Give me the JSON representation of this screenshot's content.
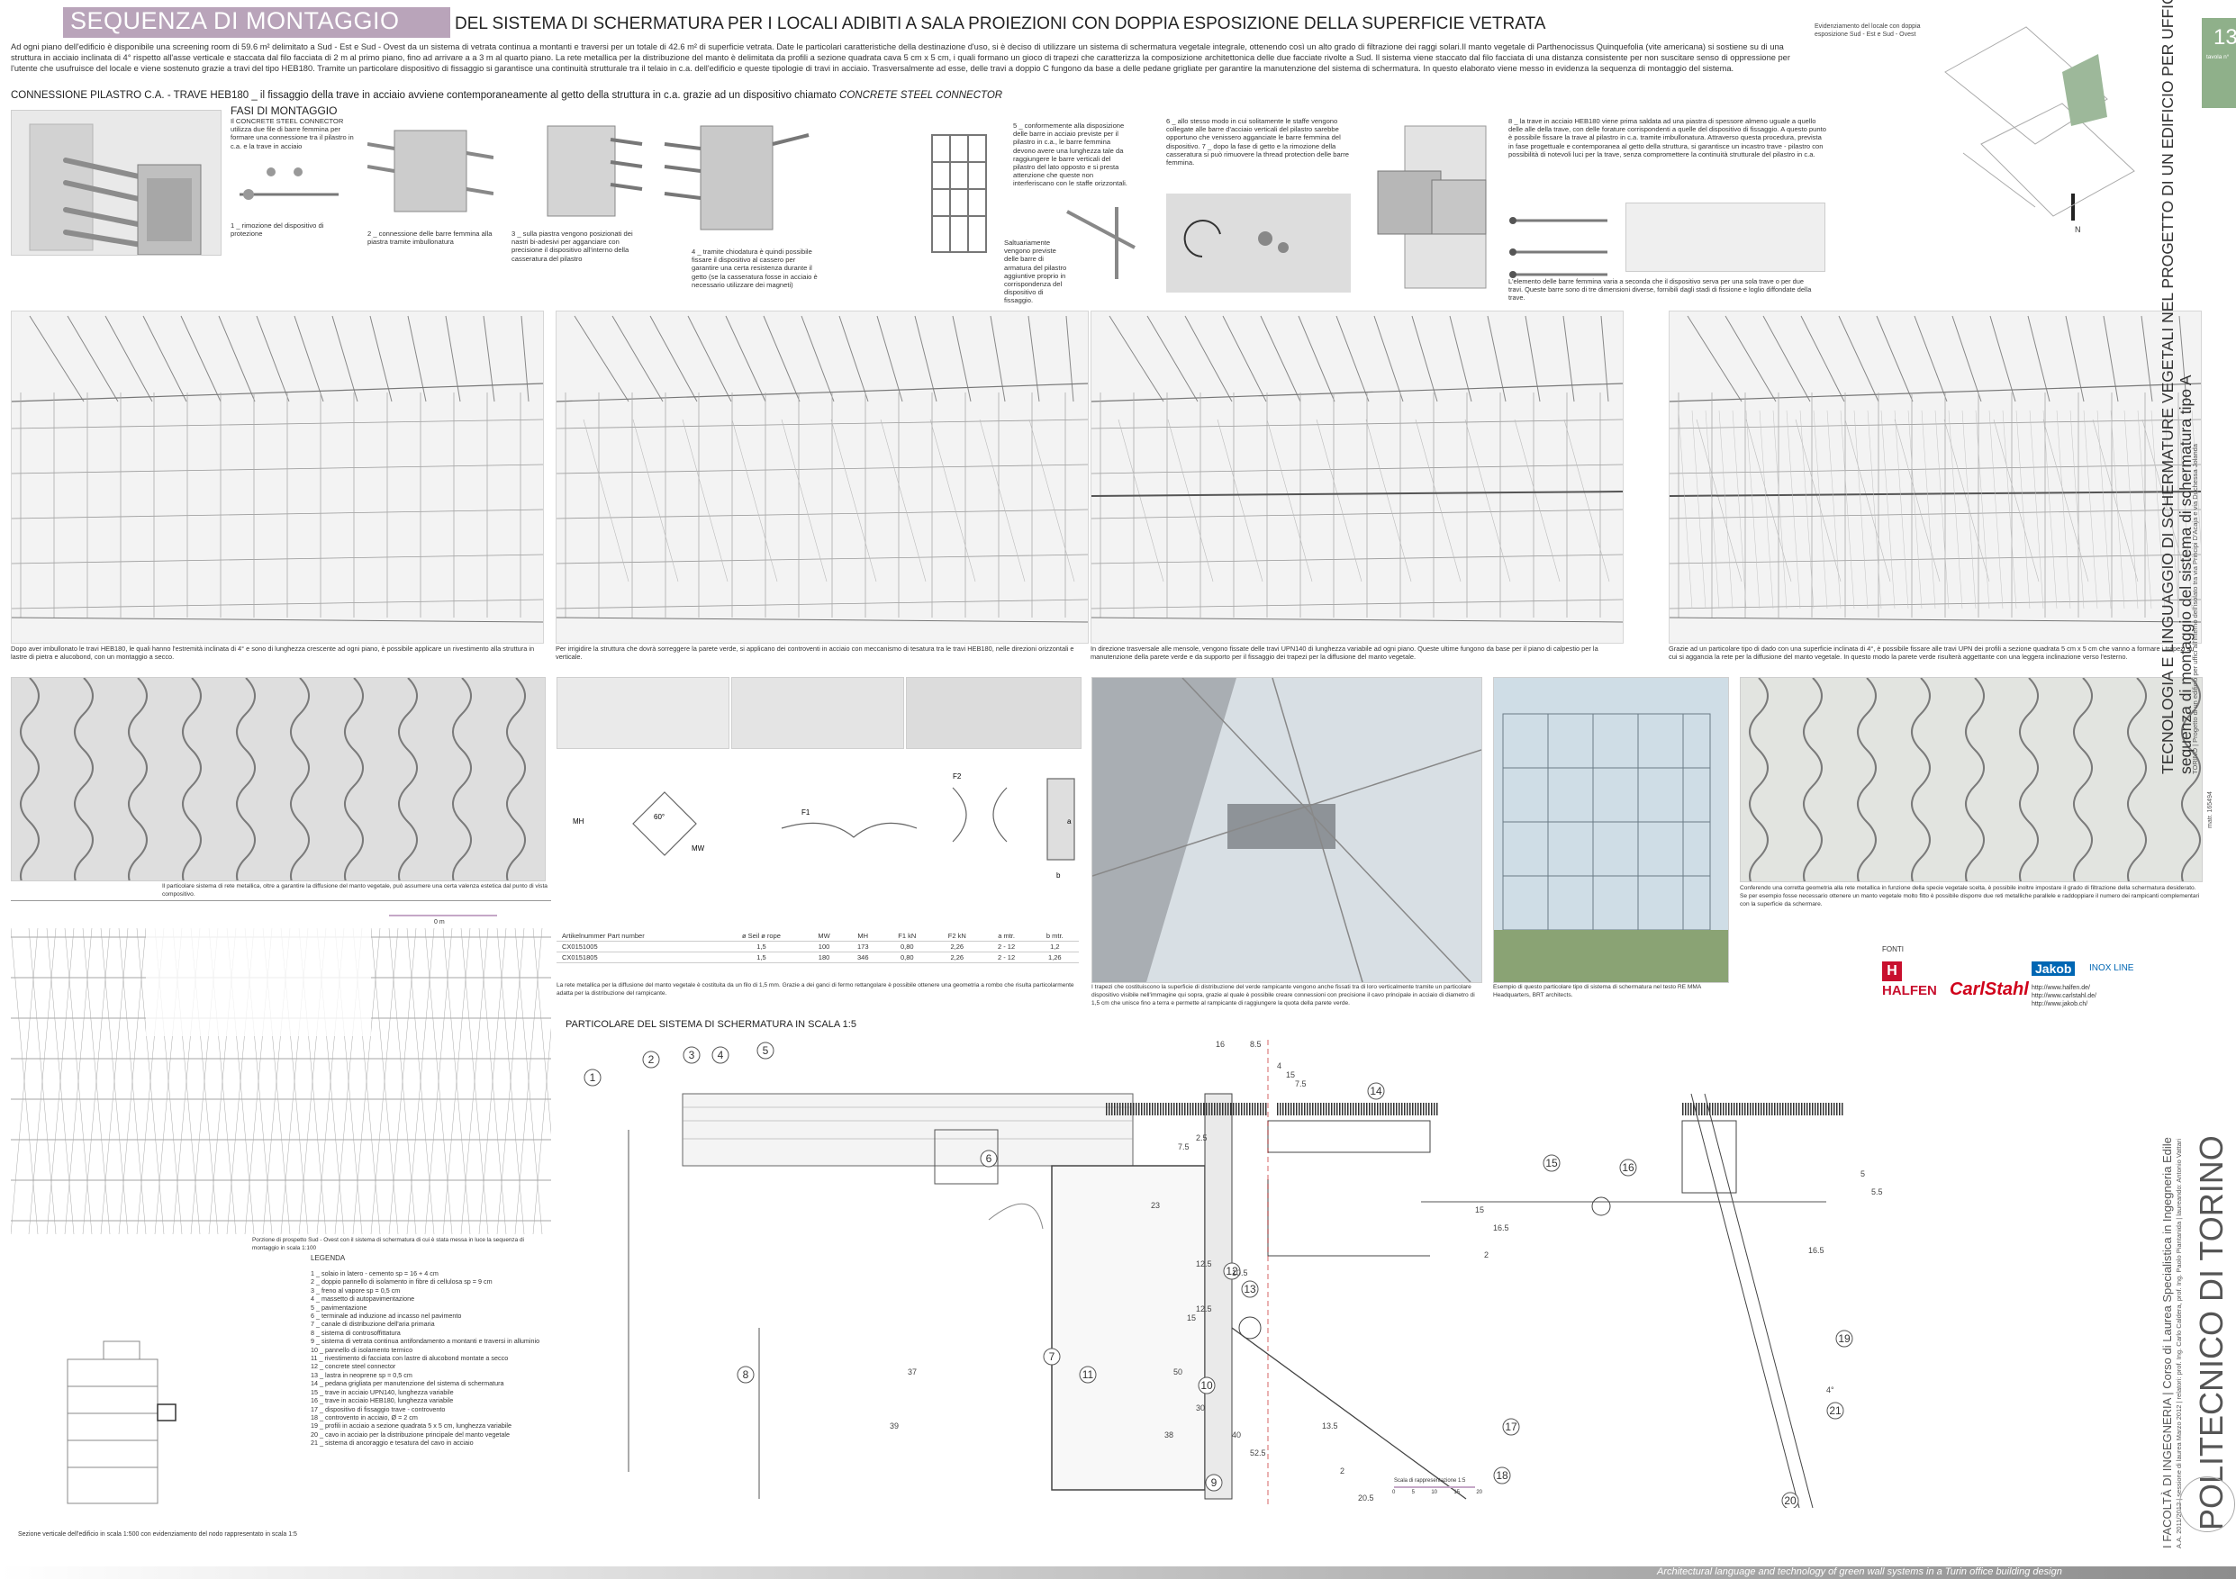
{
  "header": {
    "title_main": "SEQUENZA DI MONTAGGIO",
    "title_sub": "DEL SISTEMA DI SCHERMATURA PER I LOCALI ADIBITI A SALA PROIEZIONI CON DOPPIA ESPOSIZIONE DELLA SUPERFICIE VETRATA",
    "intro": "Ad ogni piano dell'edificio è disponibile una screening room di 59.6 m² delimitato a Sud - Est e Sud - Ovest da un sistema di vetrata continua a montanti e traversi per un totale di 42.6 m² di superficie vetrata. Date le particolari caratteristiche della destinazione d'uso, si è deciso di utilizzare un sistema di schermatura vegetale integrale, ottenendo così un alto grado di filtrazione dei raggi solari.Il manto vegetale di Parthenocissus Quinquefolia (vite americana) si sostiene su di una struttura in acciaio inclinata di 4° rispetto all'asse verticale e staccata dal filo facciata di 2 m al primo piano, fino ad arrivare a a 3 m al quarto piano. La rete metallica per la distribuzione del manto è delimitata da profili a sezione quadrata cava 5 cm x 5 cm, i quali formano un gioco di trapezi che caratterizza la composizione architettonica delle due facciate rivolte a Sud. Il sistema viene staccato dal filo facciata di una distanza consistente per non suscitare senso di oppressione per l'utente che usufruisce del locale e viene sostenuto grazie a travi del tipo HEB180. Tramite un particolare dispositivo di fissaggio si garantisce una continuità strutturale tra il telaio in c.a. dell'edificio e queste tipologie di travi in acciaio. Trasversalmente ad esse, delle travi a doppio C fungono da base a delle pedane grigliate per garantire la manutenzione del sistema di schermatura. In questo elaborato viene messo in evidenza la sequenza di montaggio del sistema.",
    "connection_title": "CONNESSIONE PILASTRO C.A. - TRAVE HEB180 _ il fissaggio della trave in acciaio avviene contemporaneamente al getto della struttura in c.a. grazie ad un dispositivo chiamato",
    "connection_title_italic": "CONCRETE STEEL CONNECTOR",
    "phases_title": "FASI DI MONTAGGIO"
  },
  "steps": [
    {
      "intro": "Il CONCRETE STEEL CONNECTOR utilizza due file di barre femmina per formare una connessione tra il pilastro in c.a. e la trave in acciaio",
      "label": "1 _ rimozione del dispositivo di protezione"
    },
    {
      "label": "2 _ connessione delle barre femmina alla piastra tramite imbullonatura"
    },
    {
      "label": "3 _ sulla piastra vengono posizionati dei nastri bi-adesivi per agganciare con precisione il dispositivo all'interno della casseratura del pilastro"
    },
    {
      "label": "4 _ tramite chiodatura è quindi possibile fissare il dispositivo al cassero per garantire una certa resistenza durante il getto (se la casseratura fosse in acciaio è necessario utilizzare dei magneti)"
    },
    {
      "label": "5 _ conformemente alla disposizione delle barre in acciaio previste per il pilastro in c.a., le barre femmina devono avere una lunghezza tale da raggiungere le barre verticali del pilastro del lato opposto e si presta attenzione che queste non interferiscano con le staffe orizzontali.",
      "extra": "Saltuariamente vengono previste delle barre di armatura del pilastro aggiuntive proprio in corrispondenza del dispositivo di fissaggio."
    },
    {
      "label": "6 _ allo stesso modo in cui solitamente le staffe vengono collegate alle barre d'acciaio verticali del pilastro sarebbe opportuno che venissero agganciate le barre femmina del dispositivo. 7 _ dopo la fase di getto e la rimozione della casseratura si può rimuovere la thread protection delle barre femmina."
    },
    {
      "label": "8 _ la trave in acciaio HEB180 viene prima saldata ad una piastra di spessore almeno uguale a quello delle alle della trave, con delle forature corrispondenti a quelle del dispositivo di fissaggio. A questo punto è possibile fissare la trave al pilastro in c.a. tramite imbullonatura. Attraverso questa procedura, prevista in fase progettuale e contemporanea al getto della struttura, si garantisce un incastro trave - pilastro con possibilità di notevoli luci per la trave, senza compromettere la continuità strutturale del pilastro in c.a."
    }
  ],
  "connector_tables": {
    "caption": "L'elemento delle barre femmina varia a seconda che il dispositivo serva per una sola trave o per due travi. Queste barre sono di tre dimensioni diverse, fornibili dagli stadi di fissione e loglio diffondate della trave."
  },
  "north_label": "N",
  "site_note": "Evidenziamento del locale con doppia esposizione Sud - Est e Sud - Ovest",
  "renders": [
    {
      "caption": "Dopo aver imbullonato le travi HEB180, le quali hanno l'estremità inclinata di 4° e sono di lunghezza crescente ad ogni piano, è possibile applicare un rivestimento alla struttura in lastre di pietra e alucobond, con un montaggio a secco."
    },
    {
      "caption": "Per irrigidire la struttura che dovrà sorreggere la parete verde, si applicano dei controventi in acciaio con meccanismo di tesatura tra le travi HEB180, nelle direzioni orizzontali e verticale."
    },
    {
      "caption": "In direzione trasversale alle mensole, vengono fissate delle travi UPN140 di lunghezza variabile ad ogni piano. Queste ultime fungono da base per il piano di calpestio per la manutenzione della parete verde e da supporto per il fissaggio dei trapezi per la diffusione del manto vegetale."
    },
    {
      "caption": "Grazie ad un particolare tipo di dado con una superficie inclinata di 4°, è possibile fissare alle travi UPN dei profili a sezione quadrata 5 cm x 5 cm che vanno a formare i trapezi su cui si aggancia la rete per la diffusione del manto vegetale. In questo modo la parete verde risulterà aggettante con una leggera inclinazione verso l'esterno."
    }
  ],
  "mesh_captions": {
    "photo1": "Il particolare sistema di rete metallica, oltre a garantire la diffusione del manto vegetale, può assumere una certa valenza estetica dal punto di vista compositivo.",
    "table_caption": "La rete metallica per la diffusione del manto vegetale è costituita da un filo di 1,5 mm. Grazie a dei ganci di fermo rettangolare è possibile ottenere una geometria a rombo che risulta particolarmente adatta per la distribuzione del rampicante.",
    "photo3": "I trapezi che costituiscono la superficie di distribuzione del verde rampicante vengono anche fissati tra di loro verticalmente tramite un particolare dispositivo visibile nell'immagine qui sopra, grazie al quale è possibile creare connessioni con precisione il cavo principale in acciaio di diametro di 1,5 cm che unisce fino a terra e permette al rampicante di raggiungere la quota della parete verde.",
    "photo4": "Esempio di questo particolare tipo di sistema di schermatura nel testo RE MMA Headquarters, BRT architects.",
    "photo5": "Conferendo una corretta geometria alla rete metallica in funzione della specie vegetale scelta, è possibile inoltre impostare il grado di filtrazione della schermatura desiderato. Se per esempio fosse necessario ottenere un manto vegetale molto fitto è possibile disporre due reti metalliche parallele e raddoppiare il numero dei rampicanti complementari con la superficie da schermare."
  },
  "mesh_table": {
    "headers": [
      "Artikelnummer Part number",
      "ø Seil ø rope",
      "MW",
      "MH",
      "F1 kN",
      "F2 kN",
      "a mtr.",
      "b mtr."
    ],
    "rows": [
      [
        "CX0151005",
        "1,5",
        "100",
        "173",
        "0,80",
        "2,26",
        "2 - 12",
        "1,2"
      ],
      [
        "CX0151805",
        "1,5",
        "180",
        "346",
        "0,80",
        "2,26",
        "2 - 12",
        "1,26"
      ]
    ],
    "diagram_labels": {
      "angle": "60°",
      "mh": "MH",
      "mw": "MW",
      "f1": "F1",
      "f2": "F2",
      "a": "a",
      "b": "b"
    }
  },
  "sources": {
    "label": "FONTI",
    "brands": [
      "HALFEN",
      "CarlStahl",
      "Jakob",
      "INOX LINE"
    ],
    "links": [
      "http://www.halfen.de/",
      "http://www.carlstahl.de/",
      "http://www.jakob.ch/"
    ]
  },
  "elevation_caption": "Porzione di prospetto Sud - Ovest con il sistema di schermatura di cui è stata messa in luce la sequenza di montaggio in scala 1:100",
  "elevation_scale": "0 m",
  "detail": {
    "title": "PARTICOLARE DEL SISTEMA DI SCHERMATURA IN SCALA 1:5",
    "scale_label": "Scala di rappresentazione 1:5",
    "scale_ticks": [
      "0",
      "5",
      "10",
      "15",
      "20"
    ],
    "numbers": [
      "1",
      "2",
      "3",
      "4",
      "5",
      "6",
      "7",
      "8",
      "9",
      "10",
      "11",
      "12",
      "13",
      "14",
      "15",
      "16",
      "17",
      "18",
      "19",
      "20",
      "21"
    ],
    "dims": [
      "16",
      "8.5",
      "4",
      "15",
      "7.5",
      "2.5",
      "7.5",
      "23",
      "12.5",
      "10.5",
      "12.5",
      "15",
      "50",
      "30",
      "40",
      "52.5",
      "38",
      "39",
      "37",
      "15",
      "16.5",
      "13.5",
      "2",
      "20.5",
      "2.5",
      "2",
      "16.5",
      "4°",
      "5",
      "5.5"
    ]
  },
  "legend": {
    "title": "LEGENDA",
    "items": [
      "1 _ solaio in latero - cemento sp = 16 + 4 cm",
      "2 _ doppio pannello di isolamento in fibre di cellulosa sp = 9 cm",
      "3 _ freno al vapore sp = 0,5 cm",
      "4 _ massetto di autopavimentazione",
      "5 _ pavimentazione",
      "6 _ terminale ad induzione ad incasso nel pavimento",
      "7 _ canale di distribuzione dell'aria primaria",
      "8 _ sistema di controsoffittatura",
      "9 _ sistema di vetrata continua antifondamento a montanti e traversi in alluminio",
      "10 _ pannello di isolamento termico",
      "11 _ rivestimento di facciata con lastre di alucobond montate a secco",
      "12 _ concrete steel connector",
      "13 _ lastra in neoprene sp = 0,5 cm",
      "14 _ pedana grigliata per manutenzione del sistema di schermatura",
      "15 _ trave in acciaio UPN140, lunghezza variabile",
      "16 _ trave in acciaio HEB180, lunghezza variabile",
      "17 _ dispositivo di fissaggio trave - controvento",
      "18 _ controvento in acciaio, Ø = 2 cm",
      "19 _ profili in acciaio a sezione quadrata 5 x 5 cm, lunghezza variabile",
      "20 _ cavo in acciaio per la distribuzione principale del manto vegetale",
      "21 _ sistema di ancoraggio e tesatura del cavo in acciaio"
    ]
  },
  "section_caption": "Sezione verticale dell'edificio in scala 1:500 con evidenziamento del nodo rappresentato in scala 1:5",
  "sidebar": {
    "main_title": "TECNOLOGIA E LINGUAGGIO DI SCHERMATURE VEGETALI NEL PROGETTO DI UN EDIFICIO PER UFFICI IN TORINO",
    "subtitle": "sequenza di montaggio del sistema di schermatura tipo A",
    "project_note": "TORINO | Progetto di un edificio per uffici all'interno dell'isolato tra via Principi D'Acaja e via Duchessa Jolanda",
    "university": "POLITECNICO DI TORINO",
    "faculty": "I FACOLTÀ DI INGEGNERIA | Corso di Laurea Specialistica in Ingegneria Edile",
    "year": "A.A. 2011/2012 | sessione di laurea Marzo 2012 | relatori: prof. Ing. Carlo Caldera, prof. Ing. Paolo Piantanida | laureando: Antonio Vattari",
    "matr": "matr. 165494",
    "table_label": "tavola n°",
    "table_number": "13"
  },
  "footer": "Architectural language and technology of green wall systems in a Turin office building design",
  "colors": {
    "accent": "#b9a4ba",
    "green": "#8fb08a",
    "footer_bg": "#a8a8a8"
  }
}
